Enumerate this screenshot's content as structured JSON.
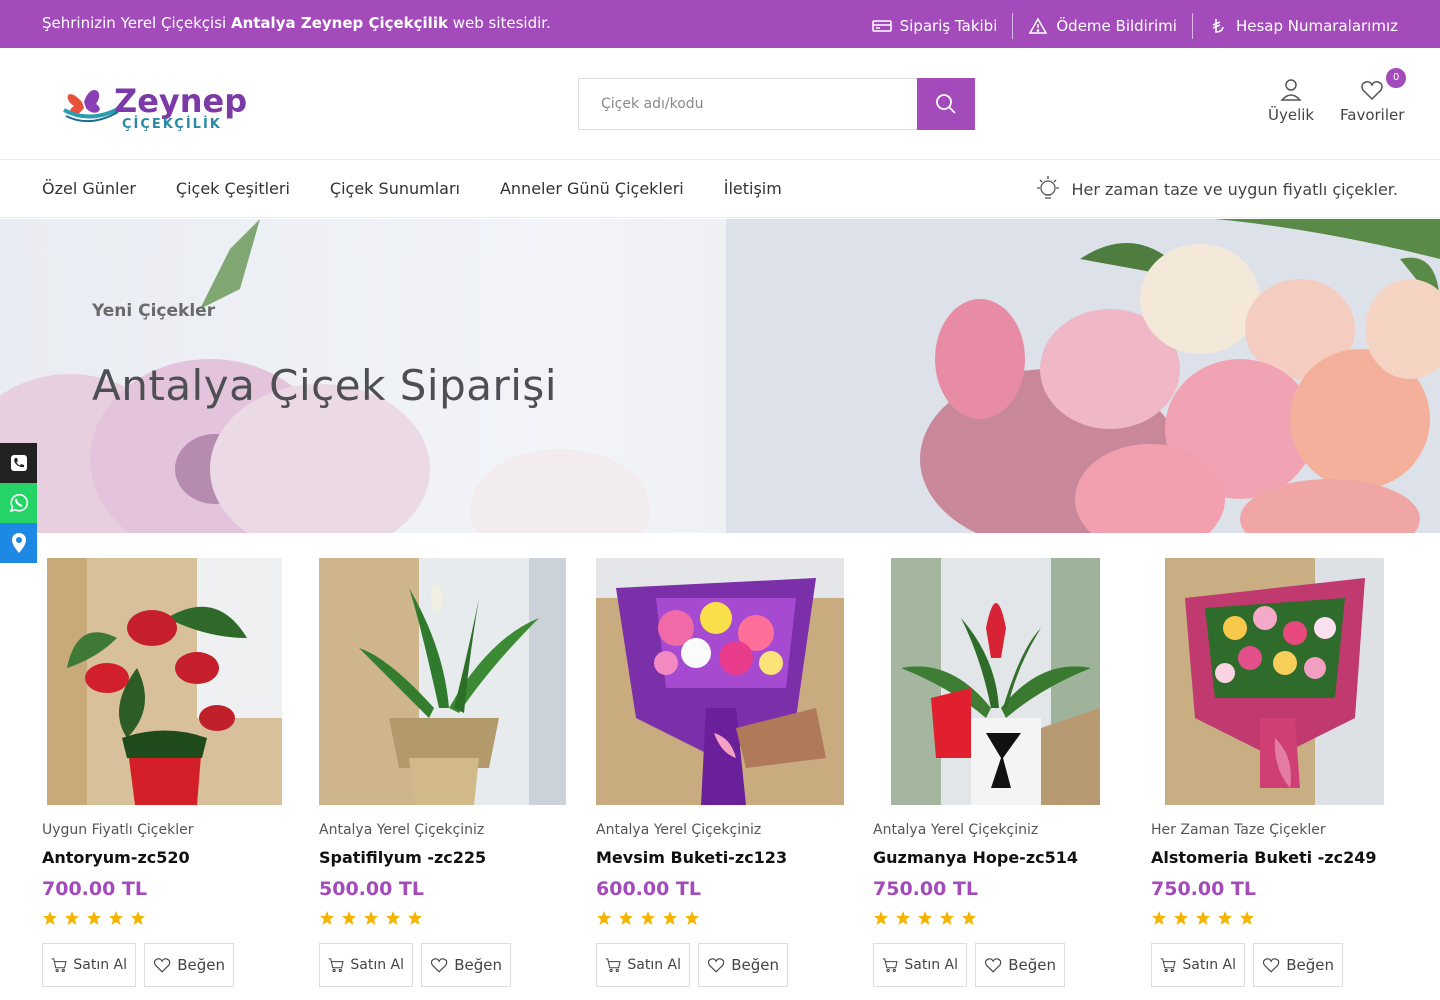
{
  "topbar": {
    "welcome_pre": "Şehrinizin Yerel Çiçekçisi",
    "welcome_bold": "Antalya Zeynep Çiçekçilik",
    "welcome_post": "web sitesidir.",
    "links": [
      {
        "label": "Sipariş Takibi",
        "icon": "truck-icon"
      },
      {
        "label": "Ödeme Bildirimi",
        "icon": "warning-icon"
      },
      {
        "label": "Hesap Numaralarımız",
        "icon": "lira-icon"
      }
    ]
  },
  "header": {
    "logo_text": "Zeynep",
    "logo_sub": "ÇİÇEKÇİLİK",
    "search_placeholder": "Çiçek adı/kodu",
    "account_label": "Üyelik",
    "favorites_label": "Favoriler",
    "favorites_count": "0"
  },
  "nav": {
    "items": [
      "Özel Günler",
      "Çiçek Çeşitleri",
      "Çiçek Sunumları",
      "Anneler Günü Çiçekleri",
      "İletişim"
    ],
    "note": "Her zaman taze ve uygun fiyatlı çiçekler."
  },
  "banner": {
    "subtitle": "Yeni Çiçekler",
    "title": "Antalya Çiçek Siparişi"
  },
  "side_buttons": [
    {
      "icon": "phone-icon",
      "color": "#222222"
    },
    {
      "icon": "whatsapp-icon",
      "color": "#25d366"
    },
    {
      "icon": "location-icon",
      "color": "#1e88e5"
    }
  ],
  "products": [
    {
      "category": "Uygun Fiyatlı Çiçekler",
      "name": "Antoryum-zc520",
      "price": "700.00 TL",
      "rating": 5,
      "buy_label": "Satın Al",
      "like_label": "Beğen"
    },
    {
      "category": "Antalya Yerel Çiçekçiniz",
      "name": "Spatifilyum -zc225",
      "price": "500.00 TL",
      "rating": 5,
      "buy_label": "Satın Al",
      "like_label": "Beğen"
    },
    {
      "category": "Antalya Yerel Çiçekçiniz",
      "name": "Mevsim Buketi-zc123",
      "price": "600.00 TL",
      "rating": 5,
      "buy_label": "Satın Al",
      "like_label": "Beğen"
    },
    {
      "category": "Antalya Yerel Çiçekçiniz",
      "name": "Guzmanya Hope-zc514",
      "price": "750.00 TL",
      "rating": 5,
      "buy_label": "Satın Al",
      "like_label": "Beğen"
    },
    {
      "category": "Her Zaman Taze Çiçekler",
      "name": "Alstomeria Buketi -zc249",
      "price": "750.00 TL",
      "rating": 5,
      "buy_label": "Satın Al",
      "like_label": "Beğen"
    }
  ],
  "colors": {
    "accent": "#a44bbb",
    "star": "#f5b400"
  }
}
